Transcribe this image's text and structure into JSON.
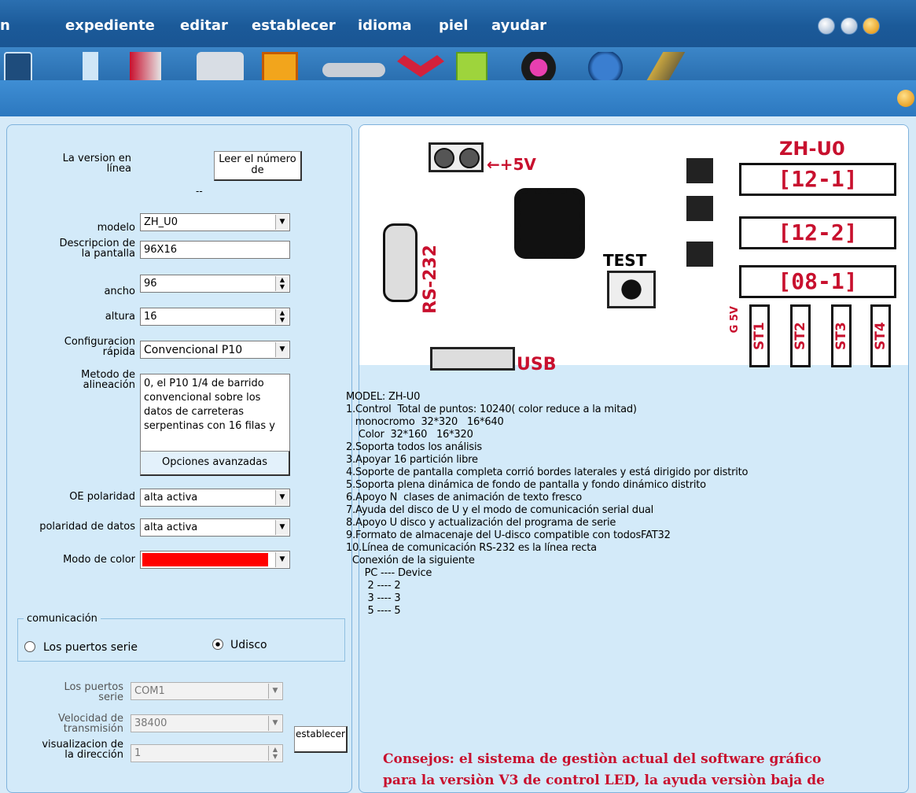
{
  "menu": {
    "m0": "n",
    "file": "expediente",
    "edit": "editar",
    "set": "establecer",
    "lang": "idioma",
    "skin": "piel",
    "help": "ayudar"
  },
  "left": {
    "version_label": "La version en línea",
    "read_button": "Leer el número de",
    "dash": "--",
    "model_label": "modelo",
    "model_value": "ZH_U0",
    "desc_label": "Descripcion de la pantalla",
    "desc_value": "96X16",
    "width_label": "ancho",
    "width_value": "96",
    "height_label": "altura",
    "height_value": "16",
    "quick_label": "Configuracion rápida",
    "quick_value": "Convencional P10",
    "align_label": "Metodo de alineación",
    "align_value": "0, el P10 1/4 de barrido convencional sobre los datos de carreteras serpentinas con 16 filas y",
    "advanced_button": "Opciones avanzadas",
    "oe_label": "OE polaridad",
    "oe_value": "alta activa",
    "data_pol_label": "polaridad de datos",
    "data_pol_value": "alta activa",
    "color_label": "Modo de color",
    "color_value": "#ff0000",
    "comm_legend": "comunicación",
    "serial_option": "Los puertos serie",
    "udisk_option": "Udisco",
    "port_label": "Los puertos serie",
    "port_value": "COM1",
    "baud_label": "Velocidad de transmisión",
    "baud_value": "38400",
    "addr_label": "visualizacion de la dirección",
    "addr_value": "1",
    "set_button": "establecer"
  },
  "board": {
    "title": "ZH-U0",
    "v5": "←+5V",
    "rs": "RS-232",
    "test": "TEST",
    "usb": "USB",
    "p1": "[12-1]",
    "p2": "[12-2]",
    "p3": "[08-1]",
    "s1": "ST1",
    "s2": "ST2",
    "s3": "ST3",
    "s4": "ST4",
    "gnd": "G 5V"
  },
  "info": "MODEL: ZH-U0\n1.Control  Total de puntos: 10240( color reduce a la mitad)\n   monocromo  32*320   16*640\n    Color  32*160   16*320\n2.Soporta todos los análisis\n3.Apoyar 16 partición libre\n4.Soporte de pantalla completa corrió bordes laterales y está dirigido por distrito\n5.Soporta plena dinámica de fondo de pantalla y fondo dinámico distrito\n6.Apoyo N  clases de animación de texto fresco\n7.Ayuda del disco de U y el modo de comunicación serial dual\n8.Apoyo U disco y actualización del programa de serie\n9.Formato de almacenaje del U-disco compatible con todosFAT32\n10.Línea de comunicación RS-232 es la línea recta\n  Conexión de la siguiente\n      PC ---- Device\n       2 ---- 2\n       3 ---- 3\n       5 ---- 5",
  "tips1": "Consejos: el sistema de gestiòn actual del software gráfico",
  "tips2": "para la versiòn V3 de control LED, la ayuda versiòn baja de"
}
